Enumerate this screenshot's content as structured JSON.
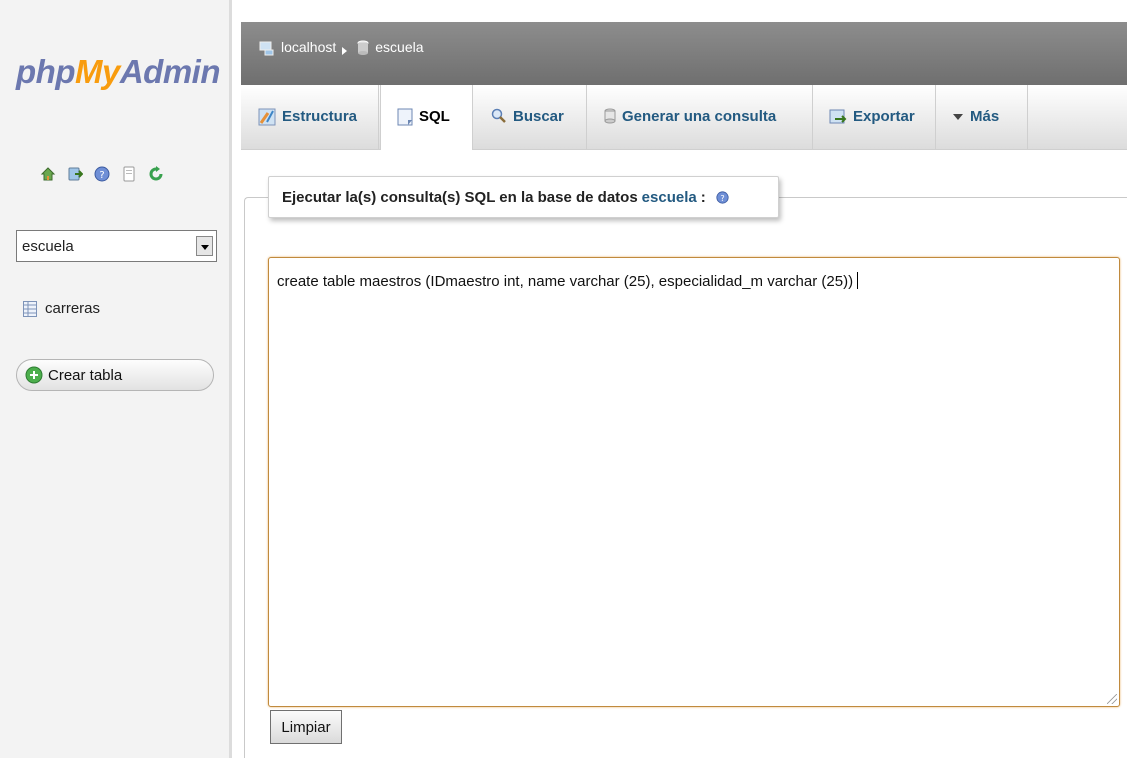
{
  "logo": {
    "part1": "php",
    "part2": "My",
    "part3": "Admin"
  },
  "nav_icons": [
    "home-icon",
    "exit-icon",
    "help-icon",
    "docs-icon",
    "reload-icon"
  ],
  "sidebar": {
    "database_select": {
      "selected": "escuela"
    },
    "tables": [
      {
        "label": "carreras",
        "icon": "table-icon"
      }
    ],
    "create_table_label": "Crear tabla"
  },
  "breadcrumb": {
    "server": "localhost",
    "database": "escuela"
  },
  "tabs": [
    {
      "label": "Estructura",
      "icon": "structure-icon"
    },
    {
      "label": "SQL",
      "icon": "sql-icon",
      "active": true
    },
    {
      "label": "Buscar",
      "icon": "search-icon"
    },
    {
      "label": "Generar una consulta",
      "icon": "query-icon"
    },
    {
      "label": "Exportar",
      "icon": "export-icon"
    },
    {
      "label": "Más",
      "icon": "more-arrow-icon"
    }
  ],
  "sql_panel": {
    "legend_text": "Ejecutar la(s) consulta(s) SQL en la base de datos",
    "legend_db": "escuela",
    "legend_colon": ":",
    "query": "create table maestros (IDmaestro int,  name varchar (25), especialidad_m varchar (25))",
    "clear_label": "Limpiar"
  },
  "colors": {
    "link": "#235a81",
    "logo_orange": "#f89c0e",
    "logo_blue": "#6c78af",
    "active_border": "#c08a3e"
  }
}
